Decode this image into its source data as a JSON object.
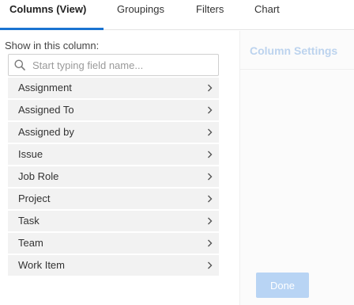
{
  "tabs": [
    {
      "label": "Columns (View)",
      "active": true
    },
    {
      "label": "Groupings",
      "active": false
    },
    {
      "label": "Filters",
      "active": false
    },
    {
      "label": "Chart",
      "active": false
    }
  ],
  "left_panel": {
    "show_label": "Show in this column:",
    "search": {
      "placeholder": "Start typing field name...",
      "value": "",
      "icon": "search-icon"
    },
    "fields": [
      {
        "label": "Assignment"
      },
      {
        "label": "Assigned To"
      },
      {
        "label": "Assigned by"
      },
      {
        "label": "Issue"
      },
      {
        "label": "Job Role"
      },
      {
        "label": "Project"
      },
      {
        "label": "Task"
      },
      {
        "label": "Team"
      },
      {
        "label": "Work Item"
      }
    ]
  },
  "right_panel": {
    "title": "Column Settings",
    "done_label": "Done"
  },
  "colors": {
    "accent": "#1a73d1",
    "disabled_button": "#b8d4f4",
    "muted_title": "#bcd3ee",
    "list_item_bg": "#f2f2f2"
  }
}
